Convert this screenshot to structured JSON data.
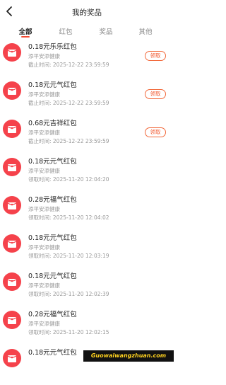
{
  "header": {
    "title": "我的奖品"
  },
  "tabs": [
    {
      "label": "全部"
    },
    {
      "label": "红包"
    },
    {
      "label": "奖品"
    },
    {
      "label": "其他"
    }
  ],
  "items": [
    {
      "title": "0.18元乐乐红包",
      "sub": "添平安添健康",
      "time": "截止时间: 2025-12-22 23:59:59",
      "action": "领取"
    },
    {
      "title": "0.18元元气红包",
      "sub": "添平安添健康",
      "time": "截止时间: 2025-12-22 23:59:59",
      "action": "领取"
    },
    {
      "title": "0.68元吉祥红包",
      "sub": "添平安添健康",
      "time": "截止时间: 2025-12-22 23:59:59",
      "action": "领取"
    },
    {
      "title": "0.18元元气红包",
      "sub": "添平安添健康",
      "time": "领取时间: 2025-11-20 12:04:20",
      "action": ""
    },
    {
      "title": "0.28元福气红包",
      "sub": "添平安添健康",
      "time": "领取时间: 2025-11-20 12:04:02",
      "action": ""
    },
    {
      "title": "0.18元元气红包",
      "sub": "添平安添健康",
      "time": "领取时间: 2025-11-20 12:03:19",
      "action": ""
    },
    {
      "title": "0.18元元气红包",
      "sub": "添平安添健康",
      "time": "领取时间: 2025-11-20 12:02:39",
      "action": ""
    },
    {
      "title": "0.28元福气红包",
      "sub": "添平安添健康",
      "time": "领取时间: 2025-11-20 12:02:15",
      "action": ""
    },
    {
      "title": "0.18元元气红包",
      "sub": "",
      "time": "",
      "action": ""
    }
  ],
  "watermark": "Guowaiwangzhuan.com",
  "colors": {
    "accent": "#f24a32",
    "icon_bg": "#f5424b"
  }
}
